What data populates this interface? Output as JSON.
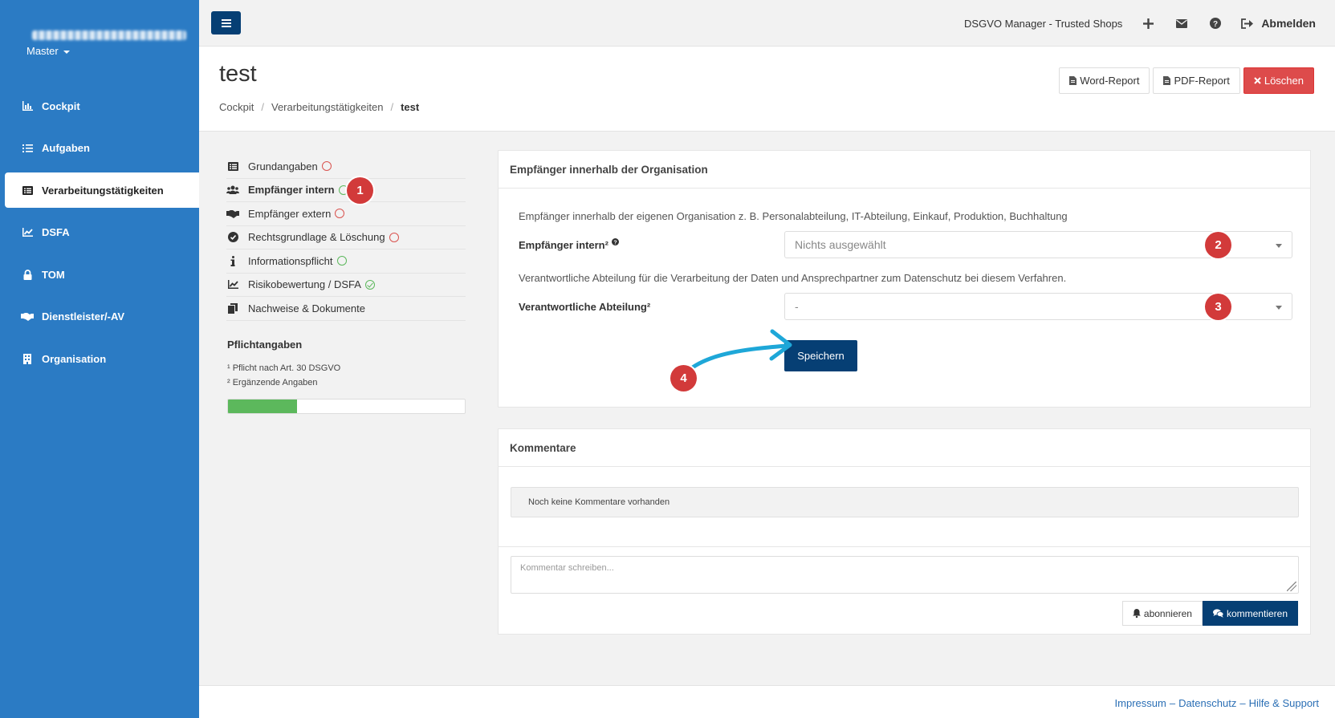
{
  "sidebar": {
    "user_label": "masked-email",
    "master_label": "Master",
    "items": [
      {
        "label": "Cockpit",
        "icon": "chart-bar-icon"
      },
      {
        "label": "Aufgaben",
        "icon": "tasks-icon"
      },
      {
        "label": "Verarbeitungstätigkeiten",
        "icon": "list-alt-icon"
      },
      {
        "label": "DSFA",
        "icon": "chart-line-icon"
      },
      {
        "label": "TOM",
        "icon": "lock-icon"
      },
      {
        "label": "Dienstleister/-AV",
        "icon": "handshake-icon"
      },
      {
        "label": "Organisation",
        "icon": "building-icon"
      }
    ]
  },
  "topbar": {
    "brand": "DSGVO Manager - Trusted Shops",
    "logout": "Abmelden"
  },
  "header": {
    "title": "test",
    "breadcrumb": [
      "Cockpit",
      "Verarbeitungstätigkeiten",
      "test"
    ],
    "word_report": "Word-Report",
    "pdf_report": "PDF-Report",
    "delete": "Löschen"
  },
  "subnav": {
    "items": [
      {
        "label": "Grundangaben",
        "status": "red"
      },
      {
        "label": "Empfänger intern",
        "status": "green"
      },
      {
        "label": "Empfänger extern",
        "status": "red"
      },
      {
        "label": "Rechtsgrundlage & Löschung",
        "status": "red"
      },
      {
        "label": "Informationspflicht",
        "status": "green"
      },
      {
        "label": "Risikobewertung / DSFA",
        "status": "check"
      },
      {
        "label": "Nachweise & Dokumente",
        "status": "none"
      }
    ],
    "pflicht_title": "Pflichtangaben",
    "note1": "¹ Pflicht nach Art. 30 DSGVO",
    "note2": "² Ergänzende Angaben",
    "progress": 0.29
  },
  "form": {
    "title": "Empfänger innerhalb der Organisation",
    "desc1": "Empfänger innerhalb der eigenen Organisation z. B. Personalabteilung, IT-Abteilung, Einkauf, Produktion, Buchhaltung",
    "label1": "Empfänger intern²",
    "select1": "Nichts ausgewählt",
    "desc2": "Verantwortliche Abteilung für die Verarbeitung der Daten und Ansprechpartner zum Datenschutz bei diesem Verfahren.",
    "label2": "Verantwortliche Abteilung²",
    "select2": "-",
    "save": "Speichern"
  },
  "markers": [
    "1",
    "2",
    "3",
    "4"
  ],
  "comments": {
    "title": "Kommentare",
    "empty": "Noch keine Kommentare vorhanden",
    "placeholder": "Kommentar schreiben...",
    "subscribe": "abonnieren",
    "comment": "kommentieren"
  },
  "footer": {
    "impressum": "Impressum",
    "datenschutz": "Datenschutz",
    "hilfe": "Hilfe & Support",
    "separator": "–"
  },
  "colors": {
    "sidebar": "#2b7bc4",
    "primary": "#063f74",
    "danger": "#dd4b4b",
    "marker": "#d23a3a",
    "arrow": "#1ea7d8",
    "progress": "#5cb85c"
  }
}
